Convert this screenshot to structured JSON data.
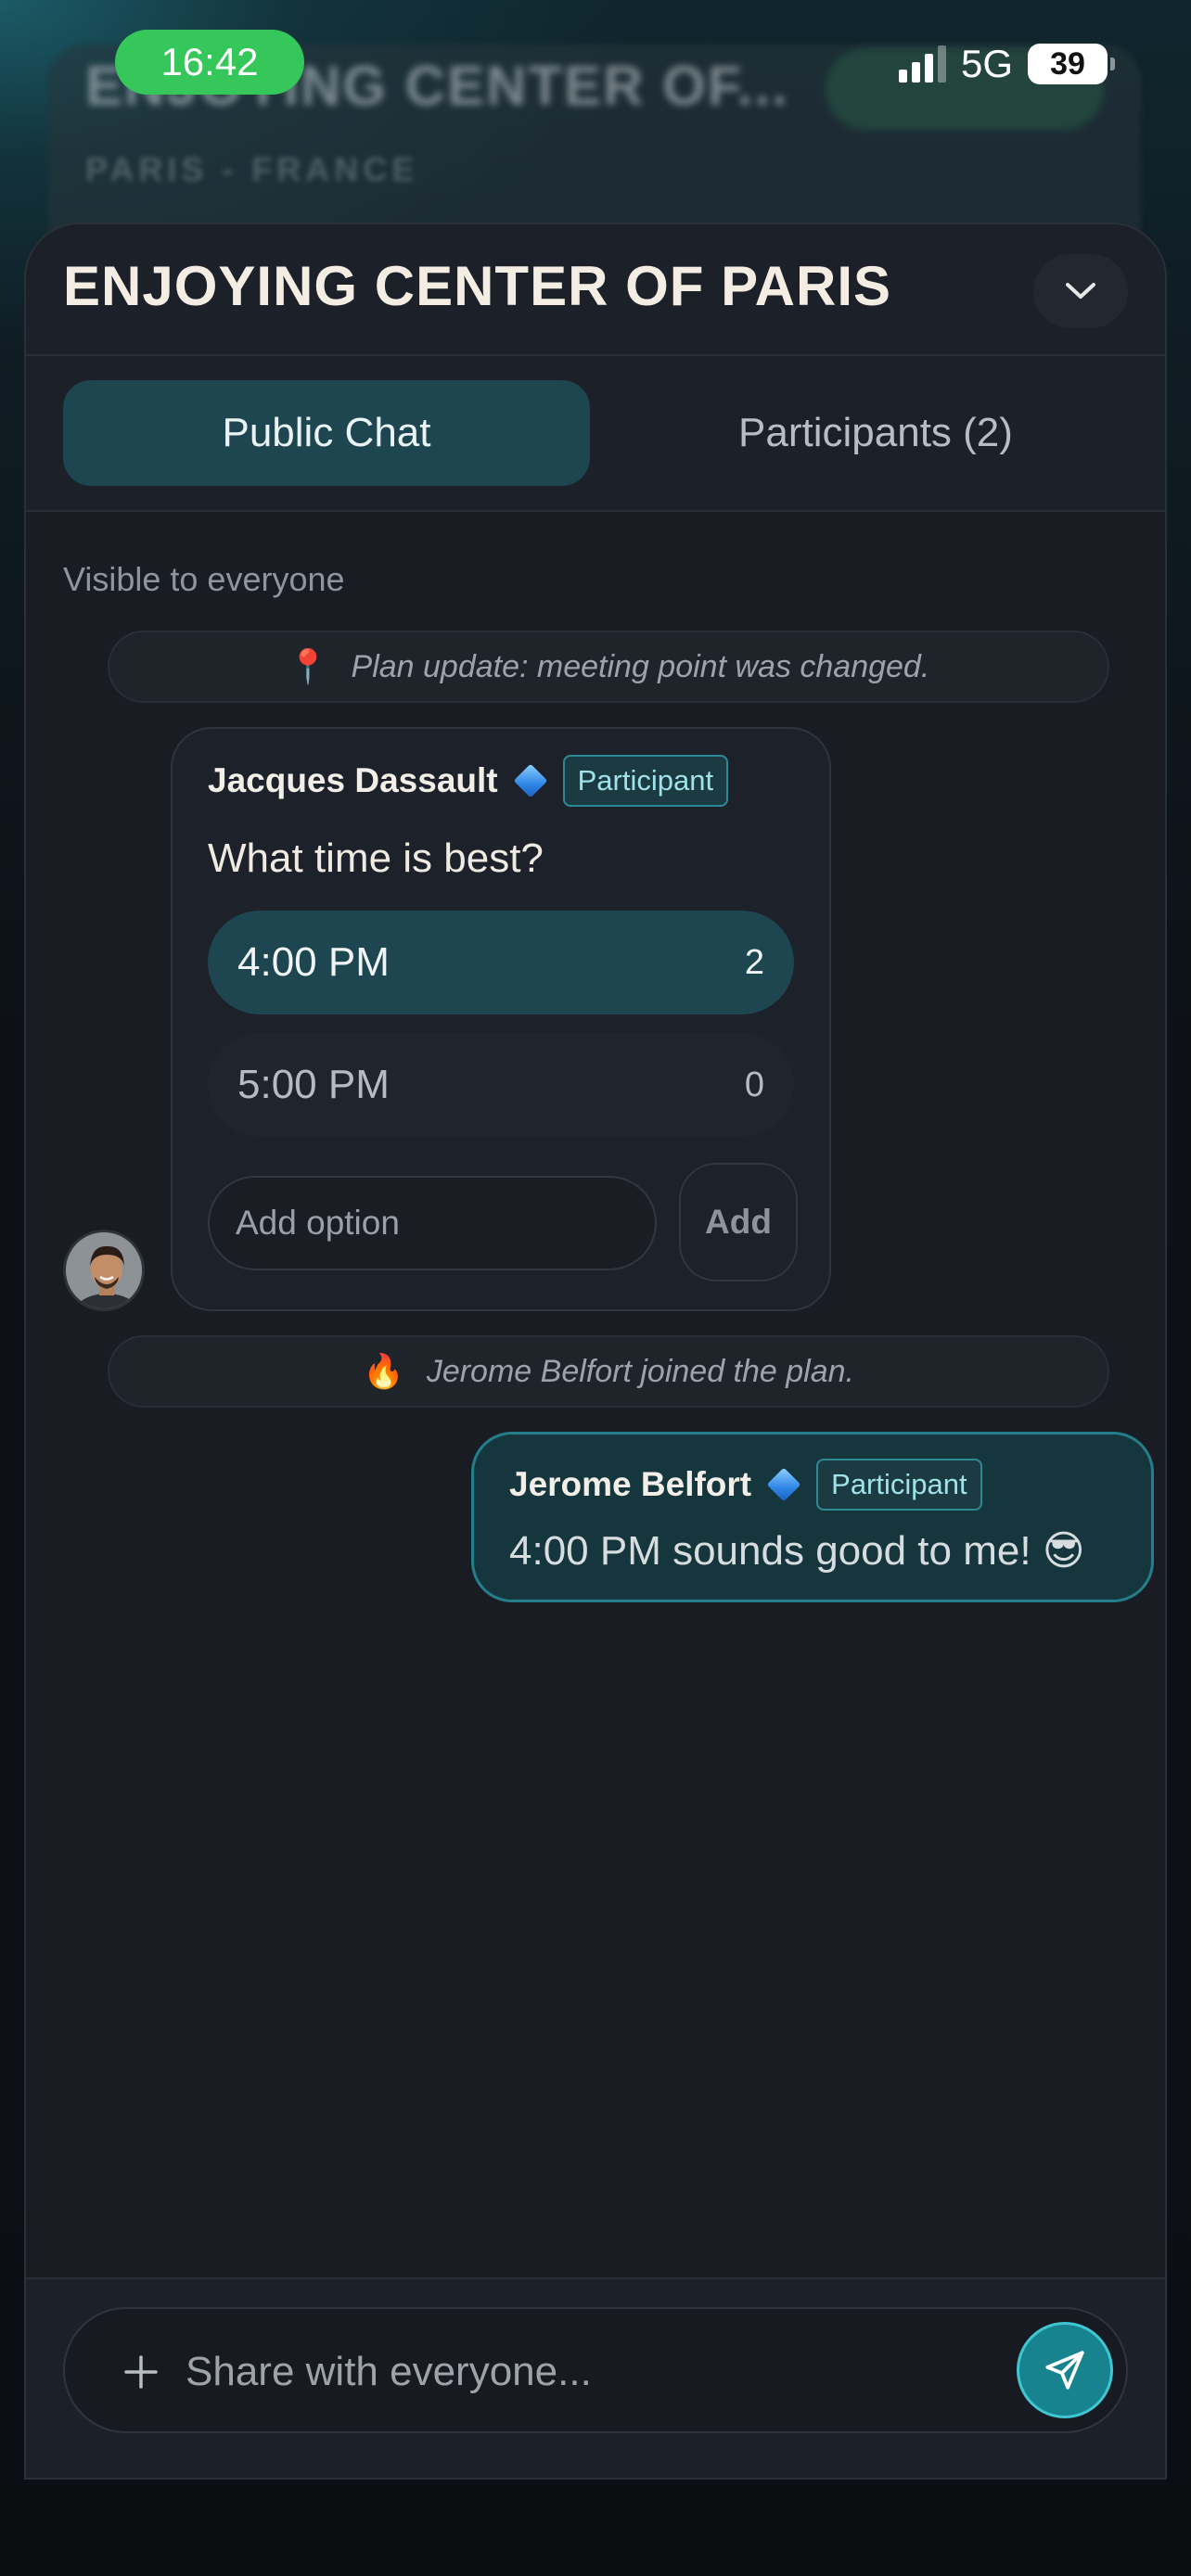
{
  "status_bar": {
    "time": "16:42",
    "network": "5G",
    "battery": "39"
  },
  "background": {
    "title": "ENJOYING CENTER OF...",
    "subtitle": "PARIS - FRANCE"
  },
  "sheet": {
    "title": "ENJOYING CENTER OF PARIS"
  },
  "tabs": [
    {
      "label": "Public Chat",
      "active": true
    },
    {
      "label": "Participants (2)",
      "active": false
    }
  ],
  "chat": {
    "visibility_note": "Visible to everyone",
    "messages": [
      {
        "type": "system",
        "emoji": "📍",
        "text": "Plan update: meeting point was changed."
      },
      {
        "type": "poll",
        "author": "Jacques Dassault",
        "role": "Participant",
        "question": "What time is best?",
        "options": [
          {
            "label": "4:00 PM",
            "count": "2",
            "selected": true
          },
          {
            "label": "5:00 PM",
            "count": "0",
            "selected": false
          }
        ],
        "add_option_placeholder": "Add option",
        "add_button_label": "Add"
      },
      {
        "type": "system",
        "emoji": "🔥",
        "text": "Jerome Belfort joined the plan."
      },
      {
        "type": "own",
        "author": "Jerome Belfort",
        "role": "Participant",
        "text": "4:00 PM sounds good to me! 😎"
      }
    ]
  },
  "composer": {
    "placeholder": "Share with everyone..."
  },
  "colors": {
    "accent": "#17838f",
    "accent_border": "#3fc6d2",
    "active_tab": "#1d4650",
    "status_green": "#35c759"
  }
}
